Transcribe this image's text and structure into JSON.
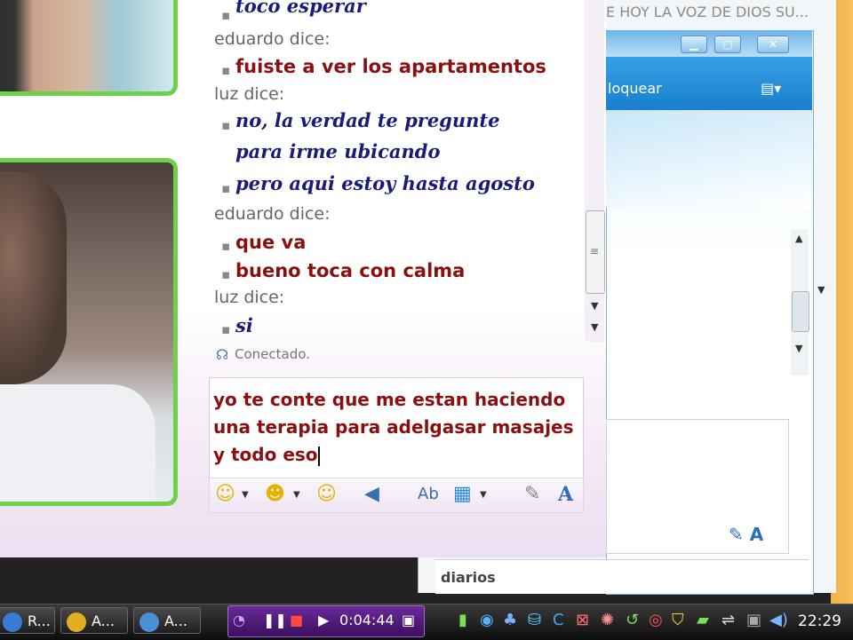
{
  "back_window": {
    "title": "E HOY LA VOZ DE DIOS SU...",
    "toolbar_text": "loquear",
    "status_text": "diarios"
  },
  "chat": {
    "messages": [
      {
        "type": "msg",
        "who": "luz",
        "text": "toco esperar"
      },
      {
        "type": "sender",
        "text": "eduardo dice:"
      },
      {
        "type": "msg",
        "who": "eduardo",
        "text": "fuiste a ver los apartamentos"
      },
      {
        "type": "sender",
        "text": "luz dice:"
      },
      {
        "type": "msg",
        "who": "luz",
        "text": "no, la verdad te pregunte"
      },
      {
        "type": "msg_cont",
        "who": "luz",
        "text": "para irme ubicando"
      },
      {
        "type": "msg",
        "who": "luz",
        "text": "pero aqui estoy hasta agosto"
      },
      {
        "type": "sender",
        "text": "eduardo dice:"
      },
      {
        "type": "msg",
        "who": "eduardo",
        "text": "que va"
      },
      {
        "type": "msg",
        "who": "eduardo",
        "text": "bueno toca con calma"
      },
      {
        "type": "sender",
        "text": "luz dice:"
      },
      {
        "type": "msg",
        "who": "luz",
        "text": "si"
      }
    ],
    "status": "Conectado.",
    "input_value": "yo te conte que me estan haciendo\nuna terapia para adelgasar masajes\ny todo eso"
  },
  "toolbar": {
    "icons": [
      "smiley-icon",
      "wink-icon",
      "winks-icon",
      "nudge-icon",
      "font-icon",
      "background-icon",
      "handwriting-icon",
      "text-style-icon"
    ]
  },
  "taskbar": {
    "tasks": [
      "R...",
      "A...",
      "A..."
    ],
    "player_time": "0:04:44",
    "clock": "22:29"
  },
  "colors": {
    "eduardo_text": "#8a1010",
    "luz_text": "#1a1a7a",
    "cam_border": "#6fd04c"
  }
}
